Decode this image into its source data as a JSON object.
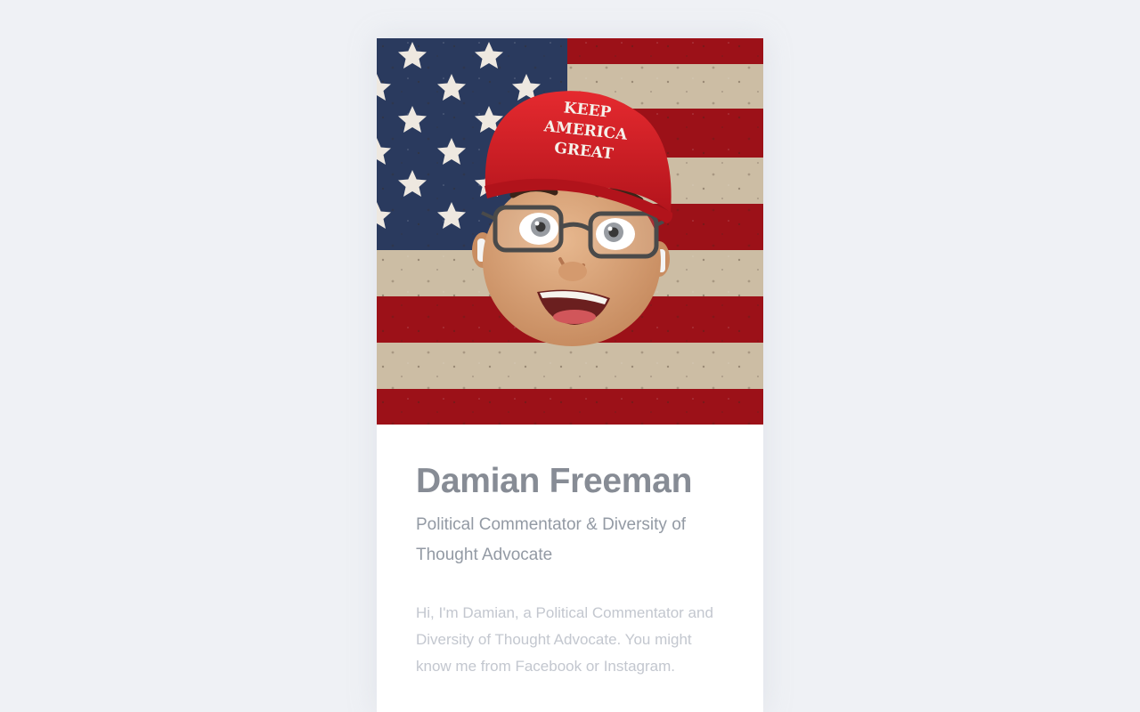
{
  "profile": {
    "cap_text_line1": "KEEP",
    "cap_text_line2": "AMERICA",
    "cap_text_line3": "GREAT",
    "name": "Damian Freeman",
    "title": "Political Commentator & Diversity of Thought Advocate",
    "bio": "Hi, I'm Damian, a Political Commentator and Diversity of Thought Advocate. You might know me from Facebook or Instagram."
  },
  "colors": {
    "page_background": "#eff1f5",
    "card_background": "#ffffff",
    "name_text": "#878c95",
    "subtitle_text": "#939aa4",
    "bio_text": "#c3c7cf",
    "flag_red": "#a4121a",
    "flag_blue": "#2a3a5e",
    "cap_red": "#d51f25"
  }
}
